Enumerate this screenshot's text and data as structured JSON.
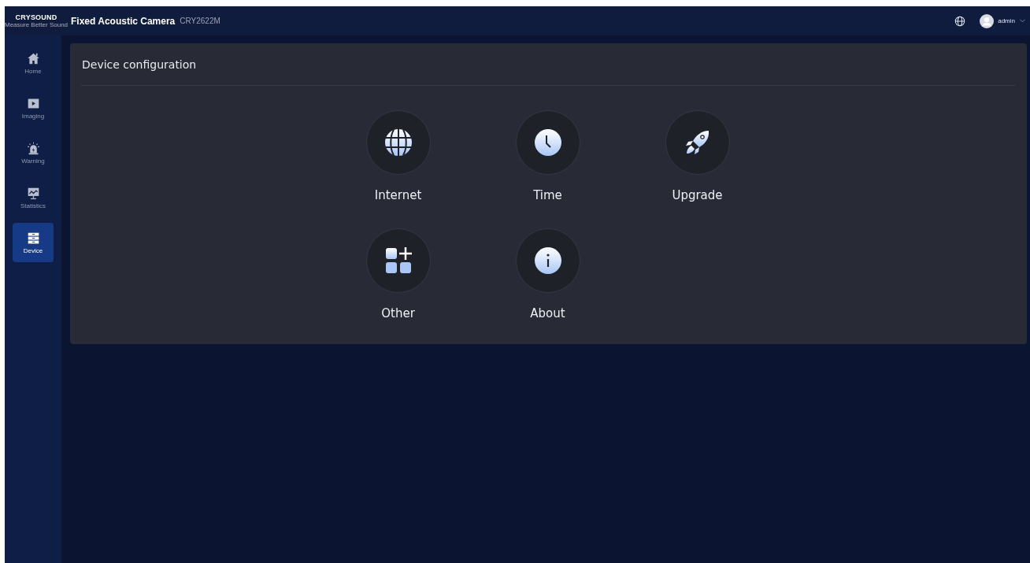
{
  "header": {
    "logo": "CRYSOUND",
    "tagline": "Measure Better Sound",
    "title": "Fixed Acoustic Camera",
    "model": "CRY2622M",
    "user": "admin"
  },
  "sidebar": {
    "items": [
      {
        "label": "Home",
        "kind": "home",
        "selected": false
      },
      {
        "label": "Imaging",
        "kind": "imaging",
        "selected": false
      },
      {
        "label": "Warning",
        "kind": "warning",
        "selected": false
      },
      {
        "label": "Statistics",
        "kind": "statistics",
        "selected": false
      },
      {
        "label": "Device",
        "kind": "device",
        "selected": true
      }
    ]
  },
  "panel": {
    "title": "Device configuration",
    "options": [
      {
        "label": "Internet",
        "kind": "globe"
      },
      {
        "label": "Time",
        "kind": "clock"
      },
      {
        "label": "Upgrade",
        "kind": "rocket"
      },
      {
        "label": "Other",
        "kind": "apps"
      },
      {
        "label": "About",
        "kind": "info"
      }
    ]
  }
}
